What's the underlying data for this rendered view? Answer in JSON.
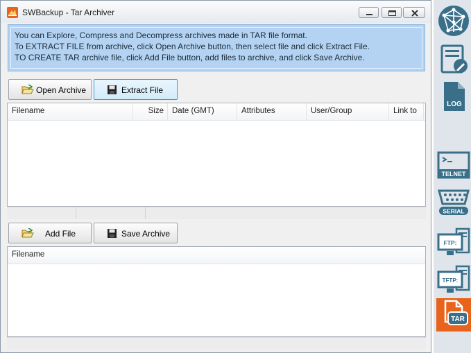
{
  "window": {
    "title": "SWBackup - Tar Archiver"
  },
  "info": {
    "lines": [
      "You can Explore, Compress and Decompress archives made in TAR file format.",
      "To EXTRACT FILE from archive, click Open Archive button, then select file and click Extract File.",
      "TO CREATE TAR archive file, click Add File button, add files to archive, and click Save Archive."
    ]
  },
  "archive_toolbar": {
    "open_label": "Open Archive",
    "extract_label": "Extract File"
  },
  "archive_list": {
    "columns": [
      "Filename",
      "Size",
      "Date (GMT)",
      "Attributes",
      "User/Group",
      "Link to"
    ],
    "rows": []
  },
  "create_toolbar": {
    "add_label": "Add File",
    "save_label": "Save Archive"
  },
  "create_list": {
    "columns": [
      "Filename"
    ],
    "rows": []
  },
  "sidebar": {
    "items": [
      {
        "icon": "network-globe-icon"
      },
      {
        "icon": "edit-document-icon"
      },
      {
        "icon": "log-file-icon",
        "label": "LOG"
      },
      {
        "icon": "telnet-terminal-icon",
        "label": "TELNET"
      },
      {
        "icon": "serial-port-icon",
        "label": "SERIAL"
      },
      {
        "icon": "ftp-server-icon",
        "label": "FTP:"
      },
      {
        "icon": "tftp-server-icon",
        "label": "TFTP:"
      },
      {
        "icon": "tar-archive-icon",
        "label": "TAR",
        "active": true
      }
    ]
  },
  "colors": {
    "info_bg": "#b4d3f2",
    "sidebar_icon": "#3a6f8a",
    "active_accent": "#e8641c"
  }
}
